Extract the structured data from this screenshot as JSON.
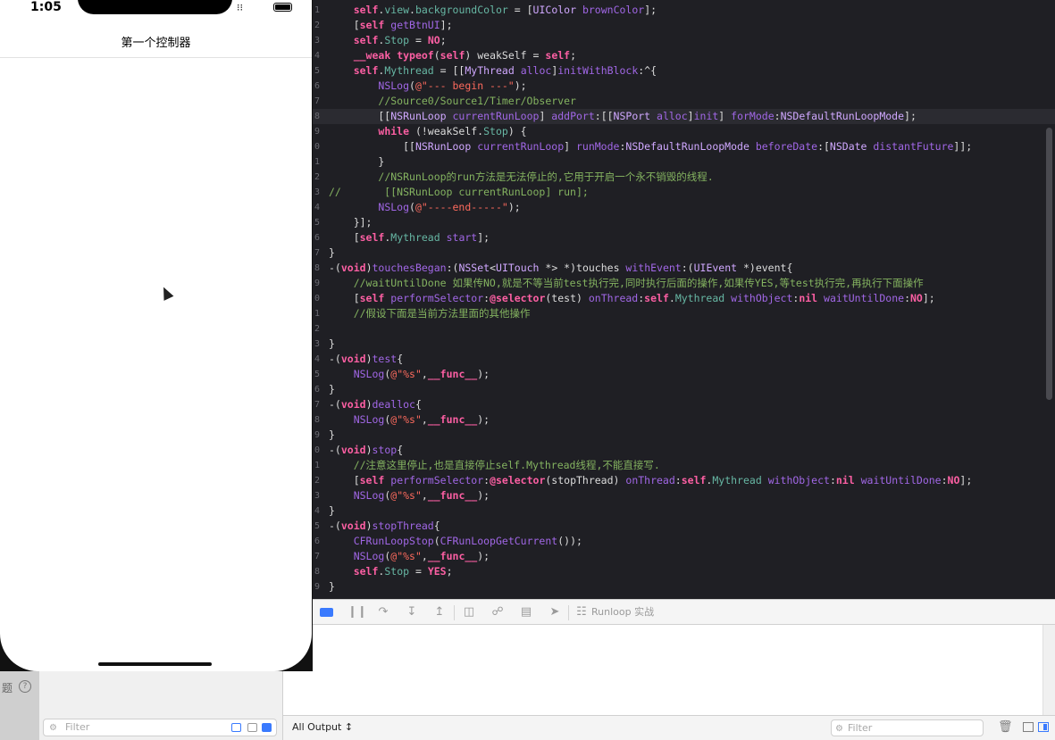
{
  "simulator": {
    "time": "1:05",
    "status_icons": "●●●",
    "nav_title": "第一个控制器"
  },
  "editor": {
    "lines": [
      {
        "ln": "1",
        "tokens": [
          [
            "    ",
            "plain"
          ],
          [
            "self",
            "kw"
          ],
          [
            ".",
            "plain"
          ],
          [
            "view",
            "prop"
          ],
          [
            ".",
            "plain"
          ],
          [
            "backgroundColor",
            "prop"
          ],
          [
            " = [",
            "plain"
          ],
          [
            "UIColor",
            "type"
          ],
          [
            " ",
            "plain"
          ],
          [
            "brownColor",
            "method"
          ],
          [
            "];",
            "plain"
          ]
        ]
      },
      {
        "ln": "2",
        "tokens": [
          [
            "    [",
            "plain"
          ],
          [
            "self",
            "kw"
          ],
          [
            " ",
            "plain"
          ],
          [
            "getBtnUI",
            "method"
          ],
          [
            "];",
            "plain"
          ]
        ]
      },
      {
        "ln": "3",
        "tokens": [
          [
            "    ",
            "plain"
          ],
          [
            "self",
            "kw"
          ],
          [
            ".",
            "plain"
          ],
          [
            "Stop",
            "prop"
          ],
          [
            " = ",
            "plain"
          ],
          [
            "NO",
            "kw"
          ],
          [
            ";",
            "plain"
          ]
        ]
      },
      {
        "ln": "4",
        "tokens": [
          [
            "    ",
            "plain"
          ],
          [
            "__weak",
            "kw"
          ],
          [
            " ",
            "plain"
          ],
          [
            "typeof",
            "kw"
          ],
          [
            "(",
            "plain"
          ],
          [
            "self",
            "kw"
          ],
          [
            ") weakSelf = ",
            "plain"
          ],
          [
            "self",
            "kw"
          ],
          [
            ";",
            "plain"
          ]
        ]
      },
      {
        "ln": "5",
        "tokens": [
          [
            "    ",
            "plain"
          ],
          [
            "self",
            "kw"
          ],
          [
            ".",
            "plain"
          ],
          [
            "Mythread",
            "prop"
          ],
          [
            " = [[",
            "plain"
          ],
          [
            "MyThread",
            "type"
          ],
          [
            " ",
            "plain"
          ],
          [
            "alloc",
            "method"
          ],
          [
            "]",
            "plain"
          ],
          [
            "initWithBlock",
            "method"
          ],
          [
            ":^{",
            "plain"
          ]
        ]
      },
      {
        "ln": "6",
        "tokens": [
          [
            "        ",
            "plain"
          ],
          [
            "NSLog",
            "method"
          ],
          [
            "(",
            "plain"
          ],
          [
            "@\"--- begin ---\"",
            "str"
          ],
          [
            ");",
            "plain"
          ]
        ]
      },
      {
        "ln": "7",
        "tokens": [
          [
            "        ",
            "plain"
          ],
          [
            "//Source0/Source1/Timer/Observer",
            "zh"
          ]
        ]
      },
      {
        "ln": "8",
        "hl": true,
        "tokens": [
          [
            "        [[",
            "plain"
          ],
          [
            "NSRunLoop",
            "type"
          ],
          [
            " ",
            "plain"
          ],
          [
            "currentRunLoop",
            "method"
          ],
          [
            "] ",
            "plain"
          ],
          [
            "addPort",
            "method"
          ],
          [
            ":[[",
            "plain"
          ],
          [
            "NSPort",
            "type"
          ],
          [
            " ",
            "plain"
          ],
          [
            "alloc",
            "method"
          ],
          [
            "]",
            "plain"
          ],
          [
            "init",
            "method"
          ],
          [
            "] ",
            "plain"
          ],
          [
            "forMode",
            "method"
          ],
          [
            ":",
            "plain"
          ],
          [
            "NSDefaultRunLoopMode",
            "type"
          ],
          [
            "];",
            "plain"
          ]
        ]
      },
      {
        "ln": "9",
        "tokens": [
          [
            "        ",
            "plain"
          ],
          [
            "while",
            "kw"
          ],
          [
            " (!weakSelf.",
            "plain"
          ],
          [
            "Stop",
            "prop"
          ],
          [
            ") {",
            "plain"
          ]
        ]
      },
      {
        "ln": "0",
        "tokens": [
          [
            "            [[",
            "plain"
          ],
          [
            "NSRunLoop",
            "type"
          ],
          [
            " ",
            "plain"
          ],
          [
            "currentRunLoop",
            "method"
          ],
          [
            "] ",
            "plain"
          ],
          [
            "runMode",
            "method"
          ],
          [
            ":",
            "plain"
          ],
          [
            "NSDefaultRunLoopMode",
            "type"
          ],
          [
            " ",
            "plain"
          ],
          [
            "beforeDate",
            "method"
          ],
          [
            ":[",
            "plain"
          ],
          [
            "NSDate",
            "type"
          ],
          [
            " ",
            "plain"
          ],
          [
            "distantFuture",
            "method"
          ],
          [
            "]];",
            "plain"
          ]
        ]
      },
      {
        "ln": "1",
        "tokens": [
          [
            "        }",
            "plain"
          ]
        ]
      },
      {
        "ln": "2",
        "tokens": [
          [
            "        ",
            "plain"
          ],
          [
            "//NSRunLoop的run方法是无法停止的,它用于开启一个永不销毁的线程.",
            "zh"
          ]
        ]
      },
      {
        "ln": "3",
        "tokens": [
          [
            "//       [[NSRunLoop currentRunLoop] run];",
            "zh"
          ]
        ]
      },
      {
        "ln": "4",
        "tokens": [
          [
            "        ",
            "plain"
          ],
          [
            "NSLog",
            "method"
          ],
          [
            "(",
            "plain"
          ],
          [
            "@\"----end-----\"",
            "str"
          ],
          [
            ");",
            "plain"
          ]
        ]
      },
      {
        "ln": "5",
        "tokens": [
          [
            "    }];",
            "plain"
          ]
        ]
      },
      {
        "ln": "6",
        "tokens": [
          [
            "    [",
            "plain"
          ],
          [
            "self",
            "kw"
          ],
          [
            ".",
            "plain"
          ],
          [
            "Mythread",
            "prop"
          ],
          [
            " ",
            "plain"
          ],
          [
            "start",
            "method"
          ],
          [
            "];",
            "plain"
          ]
        ]
      },
      {
        "ln": "7",
        "tokens": [
          [
            "}",
            "plain"
          ]
        ]
      },
      {
        "ln": "8",
        "tokens": [
          [
            "-(",
            "plain"
          ],
          [
            "void",
            "kw"
          ],
          [
            ")",
            "plain"
          ],
          [
            "touchesBegan",
            "method"
          ],
          [
            ":(",
            "plain"
          ],
          [
            "NSSet",
            "type"
          ],
          [
            "<",
            "plain"
          ],
          [
            "UITouch",
            "type"
          ],
          [
            " *> *)touches ",
            "plain"
          ],
          [
            "withEvent",
            "method"
          ],
          [
            ":(",
            "plain"
          ],
          [
            "UIEvent",
            "type"
          ],
          [
            " *)event{",
            "plain"
          ]
        ]
      },
      {
        "ln": "9",
        "tokens": [
          [
            "    ",
            "plain"
          ],
          [
            "//waitUntilDone 如果传NO,就是不等当前test执行完,同时执行后面的操作,如果传YES,等test执行完,再执行下面操作",
            "zh"
          ]
        ]
      },
      {
        "ln": "0",
        "tokens": [
          [
            "    [",
            "plain"
          ],
          [
            "self",
            "kw"
          ],
          [
            " ",
            "plain"
          ],
          [
            "performSelector",
            "method"
          ],
          [
            ":",
            "plain"
          ],
          [
            "@selector",
            "kw"
          ],
          [
            "(test) ",
            "plain"
          ],
          [
            "onThread",
            "method"
          ],
          [
            ":",
            "plain"
          ],
          [
            "self",
            "kw"
          ],
          [
            ".",
            "plain"
          ],
          [
            "Mythread",
            "prop"
          ],
          [
            " ",
            "plain"
          ],
          [
            "withObject",
            "method"
          ],
          [
            ":",
            "plain"
          ],
          [
            "nil",
            "kw"
          ],
          [
            " ",
            "plain"
          ],
          [
            "waitUntilDone",
            "method"
          ],
          [
            ":",
            "plain"
          ],
          [
            "NO",
            "kw"
          ],
          [
            "];",
            "plain"
          ]
        ]
      },
      {
        "ln": "1",
        "tokens": [
          [
            "    ",
            "plain"
          ],
          [
            "//假设下面是当前方法里面的其他操作",
            "zh"
          ]
        ]
      },
      {
        "ln": "2",
        "tokens": [
          [
            "",
            "plain"
          ]
        ]
      },
      {
        "ln": "3",
        "tokens": [
          [
            "}",
            "plain"
          ]
        ]
      },
      {
        "ln": "4",
        "tokens": [
          [
            "-(",
            "plain"
          ],
          [
            "void",
            "kw"
          ],
          [
            ")",
            "plain"
          ],
          [
            "test",
            "method"
          ],
          [
            "{",
            "plain"
          ]
        ]
      },
      {
        "ln": "5",
        "tokens": [
          [
            "    ",
            "plain"
          ],
          [
            "NSLog",
            "method"
          ],
          [
            "(",
            "plain"
          ],
          [
            "@\"%s\"",
            "str"
          ],
          [
            ",",
            "plain"
          ],
          [
            "__func__",
            "kw"
          ],
          [
            ");",
            "plain"
          ]
        ]
      },
      {
        "ln": "6",
        "tokens": [
          [
            "}",
            "plain"
          ]
        ]
      },
      {
        "ln": "7",
        "tokens": [
          [
            "-(",
            "plain"
          ],
          [
            "void",
            "kw"
          ],
          [
            ")",
            "plain"
          ],
          [
            "dealloc",
            "method"
          ],
          [
            "{",
            "plain"
          ]
        ]
      },
      {
        "ln": "8",
        "tokens": [
          [
            "    ",
            "plain"
          ],
          [
            "NSLog",
            "method"
          ],
          [
            "(",
            "plain"
          ],
          [
            "@\"%s\"",
            "str"
          ],
          [
            ",",
            "plain"
          ],
          [
            "__func__",
            "kw"
          ],
          [
            ");",
            "plain"
          ]
        ]
      },
      {
        "ln": "9",
        "tokens": [
          [
            "}",
            "plain"
          ]
        ]
      },
      {
        "ln": "0",
        "tokens": [
          [
            "-(",
            "plain"
          ],
          [
            "void",
            "kw"
          ],
          [
            ")",
            "plain"
          ],
          [
            "stop",
            "method"
          ],
          [
            "{",
            "plain"
          ]
        ]
      },
      {
        "ln": "1",
        "tokens": [
          [
            "    ",
            "plain"
          ],
          [
            "//注意这里停止,也是直接停止self.Mythread线程,不能直接写.",
            "zh"
          ]
        ]
      },
      {
        "ln": "2",
        "tokens": [
          [
            "    [",
            "plain"
          ],
          [
            "self",
            "kw"
          ],
          [
            " ",
            "plain"
          ],
          [
            "performSelector",
            "method"
          ],
          [
            ":",
            "plain"
          ],
          [
            "@selector",
            "kw"
          ],
          [
            "(stopThread) ",
            "plain"
          ],
          [
            "onThread",
            "method"
          ],
          [
            ":",
            "plain"
          ],
          [
            "self",
            "kw"
          ],
          [
            ".",
            "plain"
          ],
          [
            "Mythread",
            "prop"
          ],
          [
            " ",
            "plain"
          ],
          [
            "withObject",
            "method"
          ],
          [
            ":",
            "plain"
          ],
          [
            "nil",
            "kw"
          ],
          [
            " ",
            "plain"
          ],
          [
            "waitUntilDone",
            "method"
          ],
          [
            ":",
            "plain"
          ],
          [
            "NO",
            "kw"
          ],
          [
            "];",
            "plain"
          ]
        ]
      },
      {
        "ln": "3",
        "tokens": [
          [
            "    ",
            "plain"
          ],
          [
            "NSLog",
            "method"
          ],
          [
            "(",
            "plain"
          ],
          [
            "@\"%s\"",
            "str"
          ],
          [
            ",",
            "plain"
          ],
          [
            "__func__",
            "kw"
          ],
          [
            ");",
            "plain"
          ]
        ]
      },
      {
        "ln": "4",
        "tokens": [
          [
            "}",
            "plain"
          ]
        ]
      },
      {
        "ln": "5",
        "tokens": [
          [
            "-(",
            "plain"
          ],
          [
            "void",
            "kw"
          ],
          [
            ")",
            "plain"
          ],
          [
            "stopThread",
            "method"
          ],
          [
            "{",
            "plain"
          ]
        ]
      },
      {
        "ln": "6",
        "tokens": [
          [
            "    ",
            "plain"
          ],
          [
            "CFRunLoopStop",
            "method"
          ],
          [
            "(",
            "plain"
          ],
          [
            "CFRunLoopGetCurrent",
            "method"
          ],
          [
            "());",
            "plain"
          ]
        ]
      },
      {
        "ln": "7",
        "tokens": [
          [
            "    ",
            "plain"
          ],
          [
            "NSLog",
            "method"
          ],
          [
            "(",
            "plain"
          ],
          [
            "@\"%s\"",
            "str"
          ],
          [
            ",",
            "plain"
          ],
          [
            "__func__",
            "kw"
          ],
          [
            ");",
            "plain"
          ]
        ]
      },
      {
        "ln": "8",
        "tokens": [
          [
            "    ",
            "plain"
          ],
          [
            "self",
            "kw"
          ],
          [
            ".",
            "plain"
          ],
          [
            "Stop",
            "prop"
          ],
          [
            " = ",
            "plain"
          ],
          [
            "YES",
            "kw"
          ],
          [
            ";",
            "plain"
          ]
        ]
      },
      {
        "ln": "9",
        "tokens": [
          [
            "}",
            "plain"
          ]
        ]
      }
    ]
  },
  "debug_bar": {
    "target": "Runloop 实战",
    "icons": [
      "breakpoints-icon",
      "pause-icon",
      "step-over-icon",
      "step-into-icon",
      "step-out-icon",
      "view-debugger-icon",
      "memory-graph-icon",
      "environment-icon",
      "location-icon",
      "scheme-icon"
    ]
  },
  "console": {
    "output_selector": "All Output ↕",
    "filter_placeholder": "Filter"
  },
  "navigator": {
    "text": "题",
    "help": "?",
    "filter_placeholder": "Filter"
  },
  "colors": {
    "editor_bg": "#1f1f24",
    "keyword": "#fc5fa3",
    "type": "#d0a8ff",
    "method": "#a167e6",
    "property": "#67b7a4",
    "string": "#fc6a5d",
    "comment_zh": "#84b360",
    "accent": "#3a7afe"
  }
}
